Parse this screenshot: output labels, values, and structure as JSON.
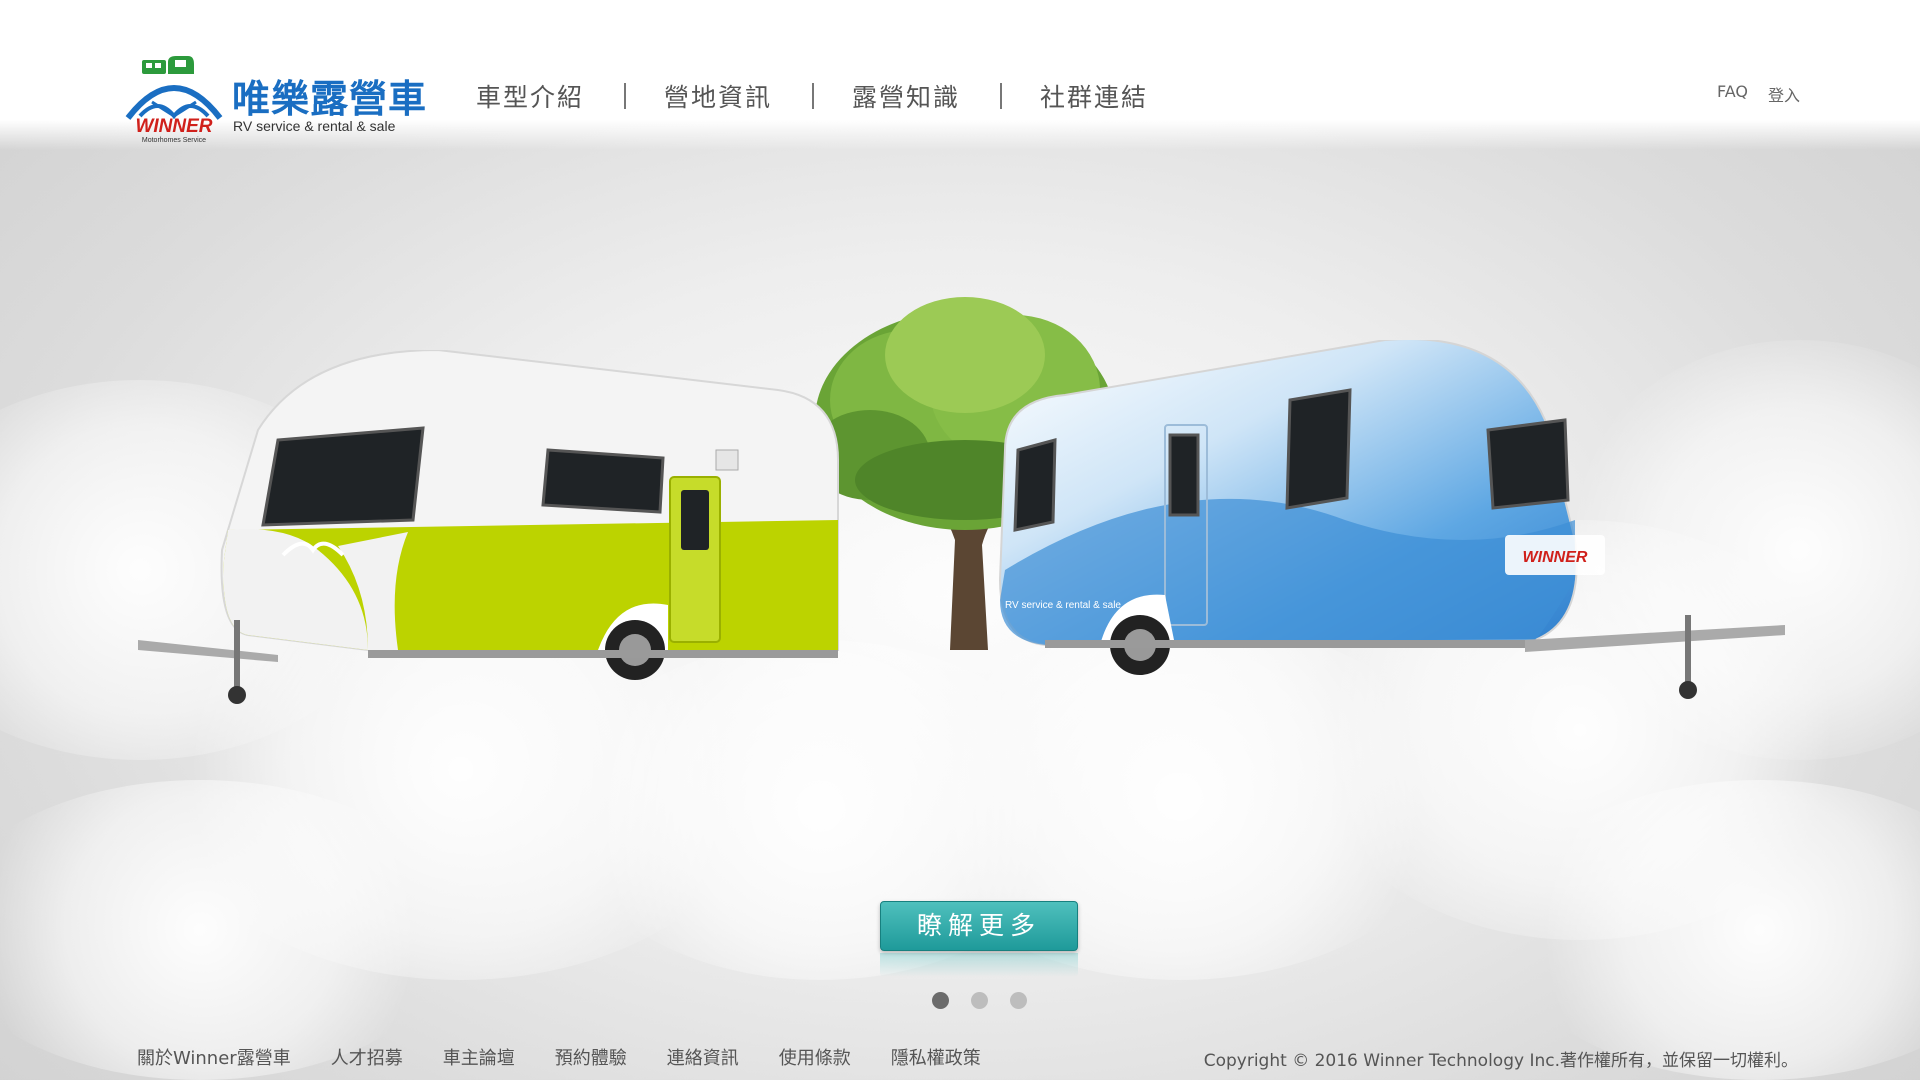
{
  "brand": {
    "name_cn": "唯樂露營車",
    "tagline": "RV service & rental & sale",
    "logo_word": "WINNER",
    "logo_sub": "Motorhomes Service",
    "colors": {
      "blue": "#1a6ec2",
      "red": "#d0201b",
      "green": "#2c9a3c"
    }
  },
  "nav": {
    "items": [
      "車型介紹",
      "營地資訊",
      "露營知識",
      "社群連結"
    ]
  },
  "utility": {
    "faq": "FAQ",
    "login": "登入"
  },
  "hero": {
    "caravan_left": {
      "color": "#bcd300",
      "icon": "caravan-green"
    },
    "caravan_right": {
      "color": "#3d8fd6",
      "icon": "caravan-blue",
      "side_text": "RV service & rental & sale",
      "badge_text": "WINNER"
    },
    "button_label": "瞭解更多",
    "button_color": "#2aa7a5",
    "slides": 3,
    "active_slide": 1
  },
  "footer": {
    "links": [
      "關於Winner露營車",
      "人才招募",
      "車主論壇",
      "預約體驗",
      "連絡資訊",
      "使用條款",
      "隱私權政策"
    ],
    "copyright": "Copyright © 2016 Winner Technology Inc.著作權所有，並保留一切權利。"
  }
}
